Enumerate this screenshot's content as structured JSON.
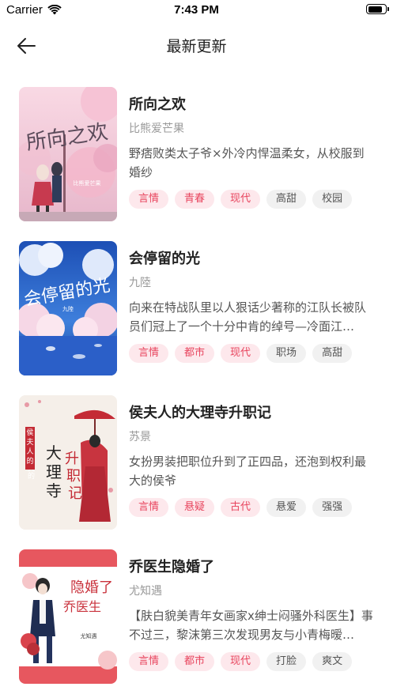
{
  "status_bar": {
    "carrier": "Carrier",
    "time": "7:43 PM",
    "battery_level": 0.85
  },
  "nav": {
    "title": "最新更新",
    "back_icon": "arrow-left-icon"
  },
  "colors": {
    "tag_pink_bg": "#fde8ec",
    "tag_pink_text": "#e8455e",
    "tag_gray_bg": "#f1f1f1",
    "tag_gray_text": "#555555"
  },
  "books": [
    {
      "title": "所向之欢",
      "author": "比熊爱芒果",
      "description": "野痞败类太子爷×外冷内悍温柔女，从校服到婚纱",
      "tags": [
        {
          "label": "言情",
          "style": "pink"
        },
        {
          "label": "青春",
          "style": "pink"
        },
        {
          "label": "现代",
          "style": "pink"
        },
        {
          "label": "高甜",
          "style": "gray"
        },
        {
          "label": "校园",
          "style": "gray"
        }
      ],
      "cover_text": "所向之欢",
      "cover_author": "比熊爱芒果"
    },
    {
      "title": "会停留的光",
      "author": "九陸",
      "description": "向来在特战队里以人狠话少著称的江队长被队员们冠上了一个十分中肯的绰号—冷面江…",
      "tags": [
        {
          "label": "言情",
          "style": "pink"
        },
        {
          "label": "都市",
          "style": "pink"
        },
        {
          "label": "现代",
          "style": "pink"
        },
        {
          "label": "职场",
          "style": "gray"
        },
        {
          "label": "高甜",
          "style": "gray"
        }
      ],
      "cover_text": "会停留的光",
      "cover_author": "九陸"
    },
    {
      "title": "侯夫人的大理寺升职记",
      "author": "苏景",
      "description": "女扮男装把职位升到了正四品，还泡到权利最大的侯爷",
      "tags": [
        {
          "label": "言情",
          "style": "pink"
        },
        {
          "label": "悬疑",
          "style": "pink"
        },
        {
          "label": "古代",
          "style": "pink"
        },
        {
          "label": "悬爱",
          "style": "gray"
        },
        {
          "label": "强强",
          "style": "gray"
        }
      ],
      "cover_text": "大理寺升职记",
      "cover_author": "侯夫人的"
    },
    {
      "title": "乔医生隐婚了",
      "author": "尤知遇",
      "description": "【肤白貌美青年女画家x绅士闷骚外科医生】事不过三，黎沫第三次发现男友与小青梅暧…",
      "tags": [
        {
          "label": "言情",
          "style": "pink"
        },
        {
          "label": "都市",
          "style": "pink"
        },
        {
          "label": "现代",
          "style": "pink"
        },
        {
          "label": "打脸",
          "style": "gray"
        },
        {
          "label": "爽文",
          "style": "gray"
        }
      ],
      "cover_text": "乔医生隐婚了",
      "cover_author": "尤知遇"
    }
  ]
}
